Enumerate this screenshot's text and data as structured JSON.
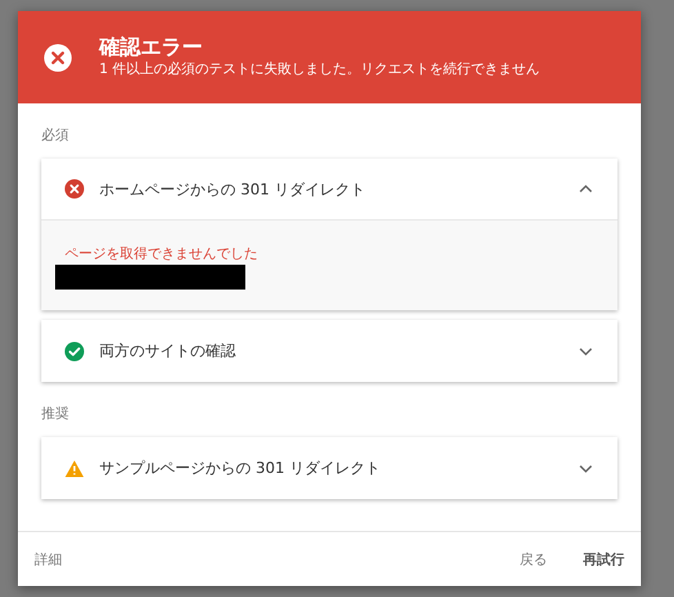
{
  "dialog": {
    "title": "確認エラー",
    "subtitle": "1 件以上の必須のテストに失敗しました。リクエストを続行できません",
    "sections": [
      {
        "label": "必須",
        "items": [
          {
            "kind": "error",
            "title": "ホームページからの 301 リダイレクト",
            "expanded": true,
            "message": "ページを取得できませんでした"
          },
          {
            "kind": "success",
            "title": "両方のサイトの確認",
            "expanded": false
          }
        ]
      },
      {
        "label": "推奨",
        "items": [
          {
            "kind": "warning",
            "title": "サンプルページからの 301 リダイレクト",
            "expanded": false
          }
        ]
      }
    ],
    "footer": {
      "details": "詳細",
      "back": "戻る",
      "retry": "再試行"
    }
  }
}
